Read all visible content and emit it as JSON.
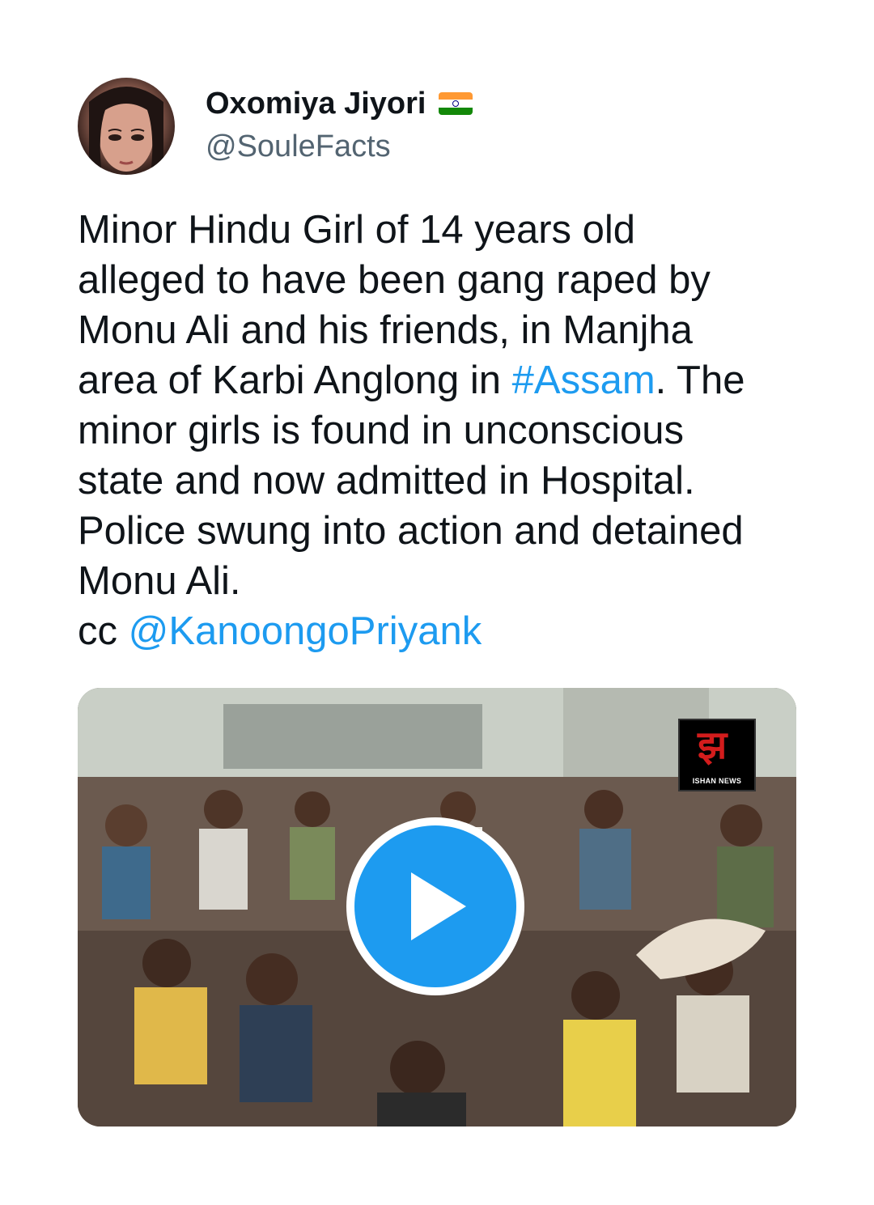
{
  "author": {
    "display_name": "Oxomiya Jiyori",
    "handle": "@SouleFacts",
    "flag_icon": "india-flag-icon",
    "avatar_icon": "profile-avatar"
  },
  "tweet": {
    "lines": [
      [
        {
          "text": "Minor Hindu Girl of 14 years old"
        }
      ],
      [
        {
          "text": "alleged to have been gang raped by"
        }
      ],
      [
        {
          "text": "Monu Ali and his friends, in Manjha"
        }
      ],
      [
        {
          "text": "area of Karbi Anglong in "
        },
        {
          "text": "#Assam",
          "link": true
        },
        {
          "text": ". The"
        }
      ],
      [
        {
          "text": "minor girls is found in unconscious"
        }
      ],
      [
        {
          "text": "state and now admitted in Hospital."
        }
      ],
      [
        {
          "text": "Police swung into action and detained"
        }
      ],
      [
        {
          "text": "Monu Ali."
        }
      ],
      [
        {
          "text": "cc "
        },
        {
          "text": "@KanoongoPriyank",
          "link": true
        }
      ]
    ]
  },
  "media": {
    "type": "video",
    "watermark": "ISHAN NEWS",
    "play_icon": "play-icon"
  },
  "colors": {
    "link": "#1d9bf0",
    "handle": "#536471",
    "text": "#0f1419"
  }
}
